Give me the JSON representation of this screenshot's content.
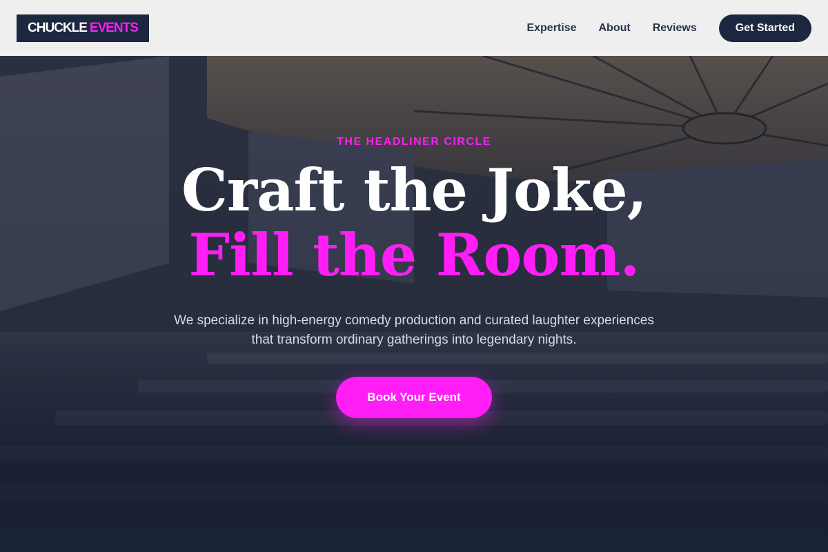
{
  "header": {
    "logo_part1": "CHUCKLE",
    "logo_part2": "EVENTS",
    "nav": [
      {
        "label": "Expertise"
      },
      {
        "label": "About"
      },
      {
        "label": "Reviews"
      }
    ],
    "cta_label": "Get Started"
  },
  "hero": {
    "eyebrow": "THE HEADLINER CIRCLE",
    "headline_line1": "Craft the Joke,",
    "headline_line2": "Fill the Room.",
    "subtext": "We specialize in high-energy comedy production and curated laughter experiences that transform ordinary gatherings into legendary nights.",
    "button_label": "Book Your Event",
    "background_image": "conference-hall-photo"
  },
  "colors": {
    "brand_dark": "#1c2740",
    "accent_magenta": "#ff1ef5",
    "header_bg": "#efefef",
    "nav_text": "#273349",
    "subtext": "#d7dbe3"
  }
}
